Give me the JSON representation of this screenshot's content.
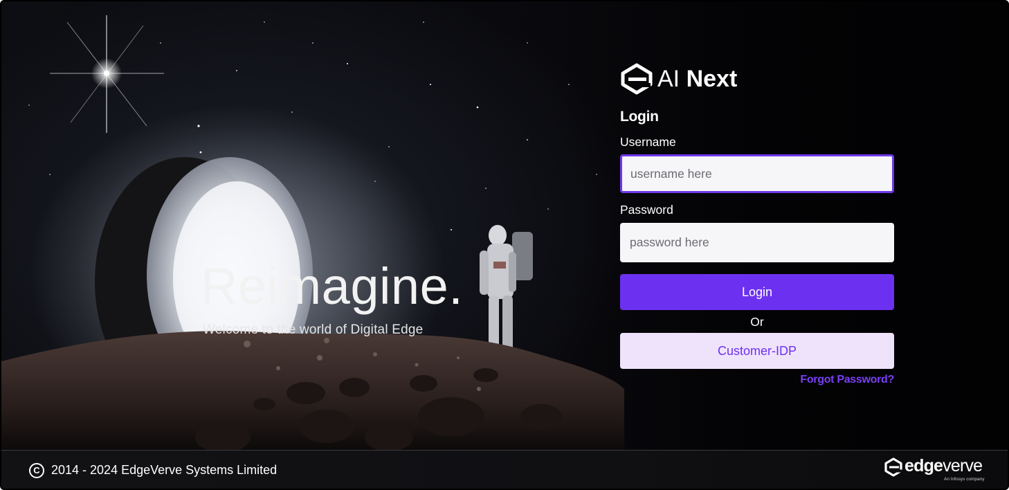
{
  "hero": {
    "title": "Reimagine.",
    "subtitle": "Welcome to the world of Digital Edge"
  },
  "brand": {
    "logo_icon": "ai-next-logo-icon",
    "name_part1": "AI",
    "name_part2": "Next"
  },
  "login_form": {
    "heading": "Login",
    "username_label": "Username",
    "username_placeholder": "username here",
    "username_value": "",
    "password_label": "Password",
    "password_placeholder": "password here",
    "password_value": "",
    "login_button": "Login",
    "or_text": "Or",
    "idp_button": "Customer-IDP",
    "forgot_password": "Forgot Password?"
  },
  "footer": {
    "copyright_icon": "copyright-icon",
    "copyright": "2014 - 2024 EdgeVerve Systems Limited",
    "company_logo_part1": "edge",
    "company_logo_part2": "verve",
    "company_tagline": "An Infosys company"
  },
  "colors": {
    "accent": "#6c31f0",
    "accent_light": "#efe3fc",
    "link": "#7a3ff5",
    "background": "#030306"
  }
}
